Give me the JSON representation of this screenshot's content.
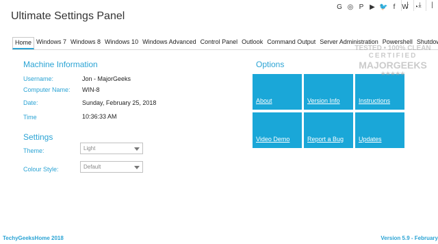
{
  "window": {
    "title": "Ultimate Settings Panel",
    "social_icons": [
      "G",
      "◎",
      "P",
      "▶",
      "🐦",
      "f",
      "W",
      "◔"
    ],
    "social_icon_names": [
      "google-icon",
      "instagram-icon",
      "pinterest-icon",
      "youtube-icon",
      "twitter-icon",
      "facebook-icon",
      "wordpress-icon",
      "rss-icon"
    ],
    "controls": [
      "|",
      "⤓",
      "|"
    ]
  },
  "tabs": [
    "Home",
    "Windows 7",
    "Windows 8",
    "Windows 10",
    "Windows Advanced",
    "Control Panel",
    "Outlook",
    "Command Output",
    "Server Administration",
    "Powershell",
    "Shutdown O"
  ],
  "machine_info": {
    "title": "Machine Information",
    "rows": [
      {
        "label": "Username:",
        "value": "Jon - MajorGeeks"
      },
      {
        "label": "Computer Name:",
        "value": "WIN-8"
      },
      {
        "label": "Date:",
        "value": "Sunday, February 25, 2018"
      },
      {
        "label": "Time",
        "value": "10:36:33 AM"
      }
    ]
  },
  "settings": {
    "title": "Settings",
    "theme_label": "Theme:",
    "theme_value": "Light",
    "colour_label": "Colour Style:",
    "colour_value": "Default"
  },
  "options": {
    "title": "Options",
    "tiles": [
      "About",
      "Version Info",
      "Instructions",
      "Video Demo",
      "Report a Bug",
      "Updates"
    ]
  },
  "watermark": {
    "line1": "TESTED • 100% CLEAN",
    "line2": "CERTIFIED",
    "line3": "MAJORGEEKS",
    "line4": "★★★★★"
  },
  "footer": {
    "left": "TechyGeeksHome 2018",
    "right": "Version 5.9 - February"
  },
  "colors": {
    "accent": "#2aa3d4",
    "tile": "#1aa7d8"
  }
}
